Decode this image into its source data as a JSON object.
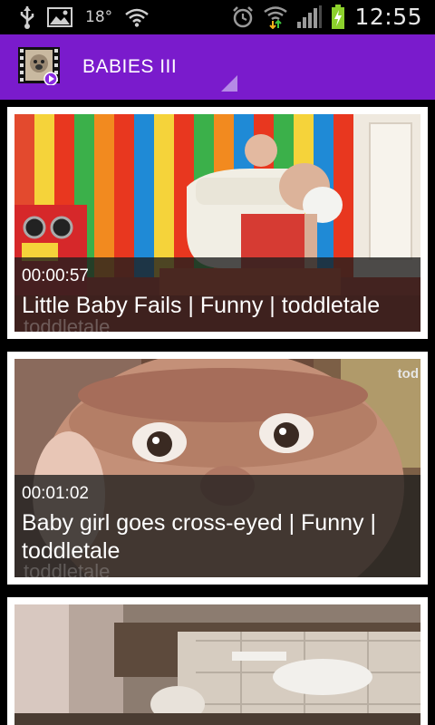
{
  "status_bar": {
    "temperature": "18°",
    "time": "12:55"
  },
  "action_bar": {
    "title": "BABIES III",
    "background_color": "#7a1bcc"
  },
  "videos": [
    {
      "duration": "00:00:57",
      "title": "Little Baby Fails | Funny | toddletale",
      "watermark": "toddletale"
    },
    {
      "duration": "00:01:02",
      "title": "Baby girl goes cross-eyed | Funny | toddletale",
      "watermark": "toddletale",
      "corner_text": "tod"
    },
    {
      "duration": "",
      "title": ""
    }
  ]
}
